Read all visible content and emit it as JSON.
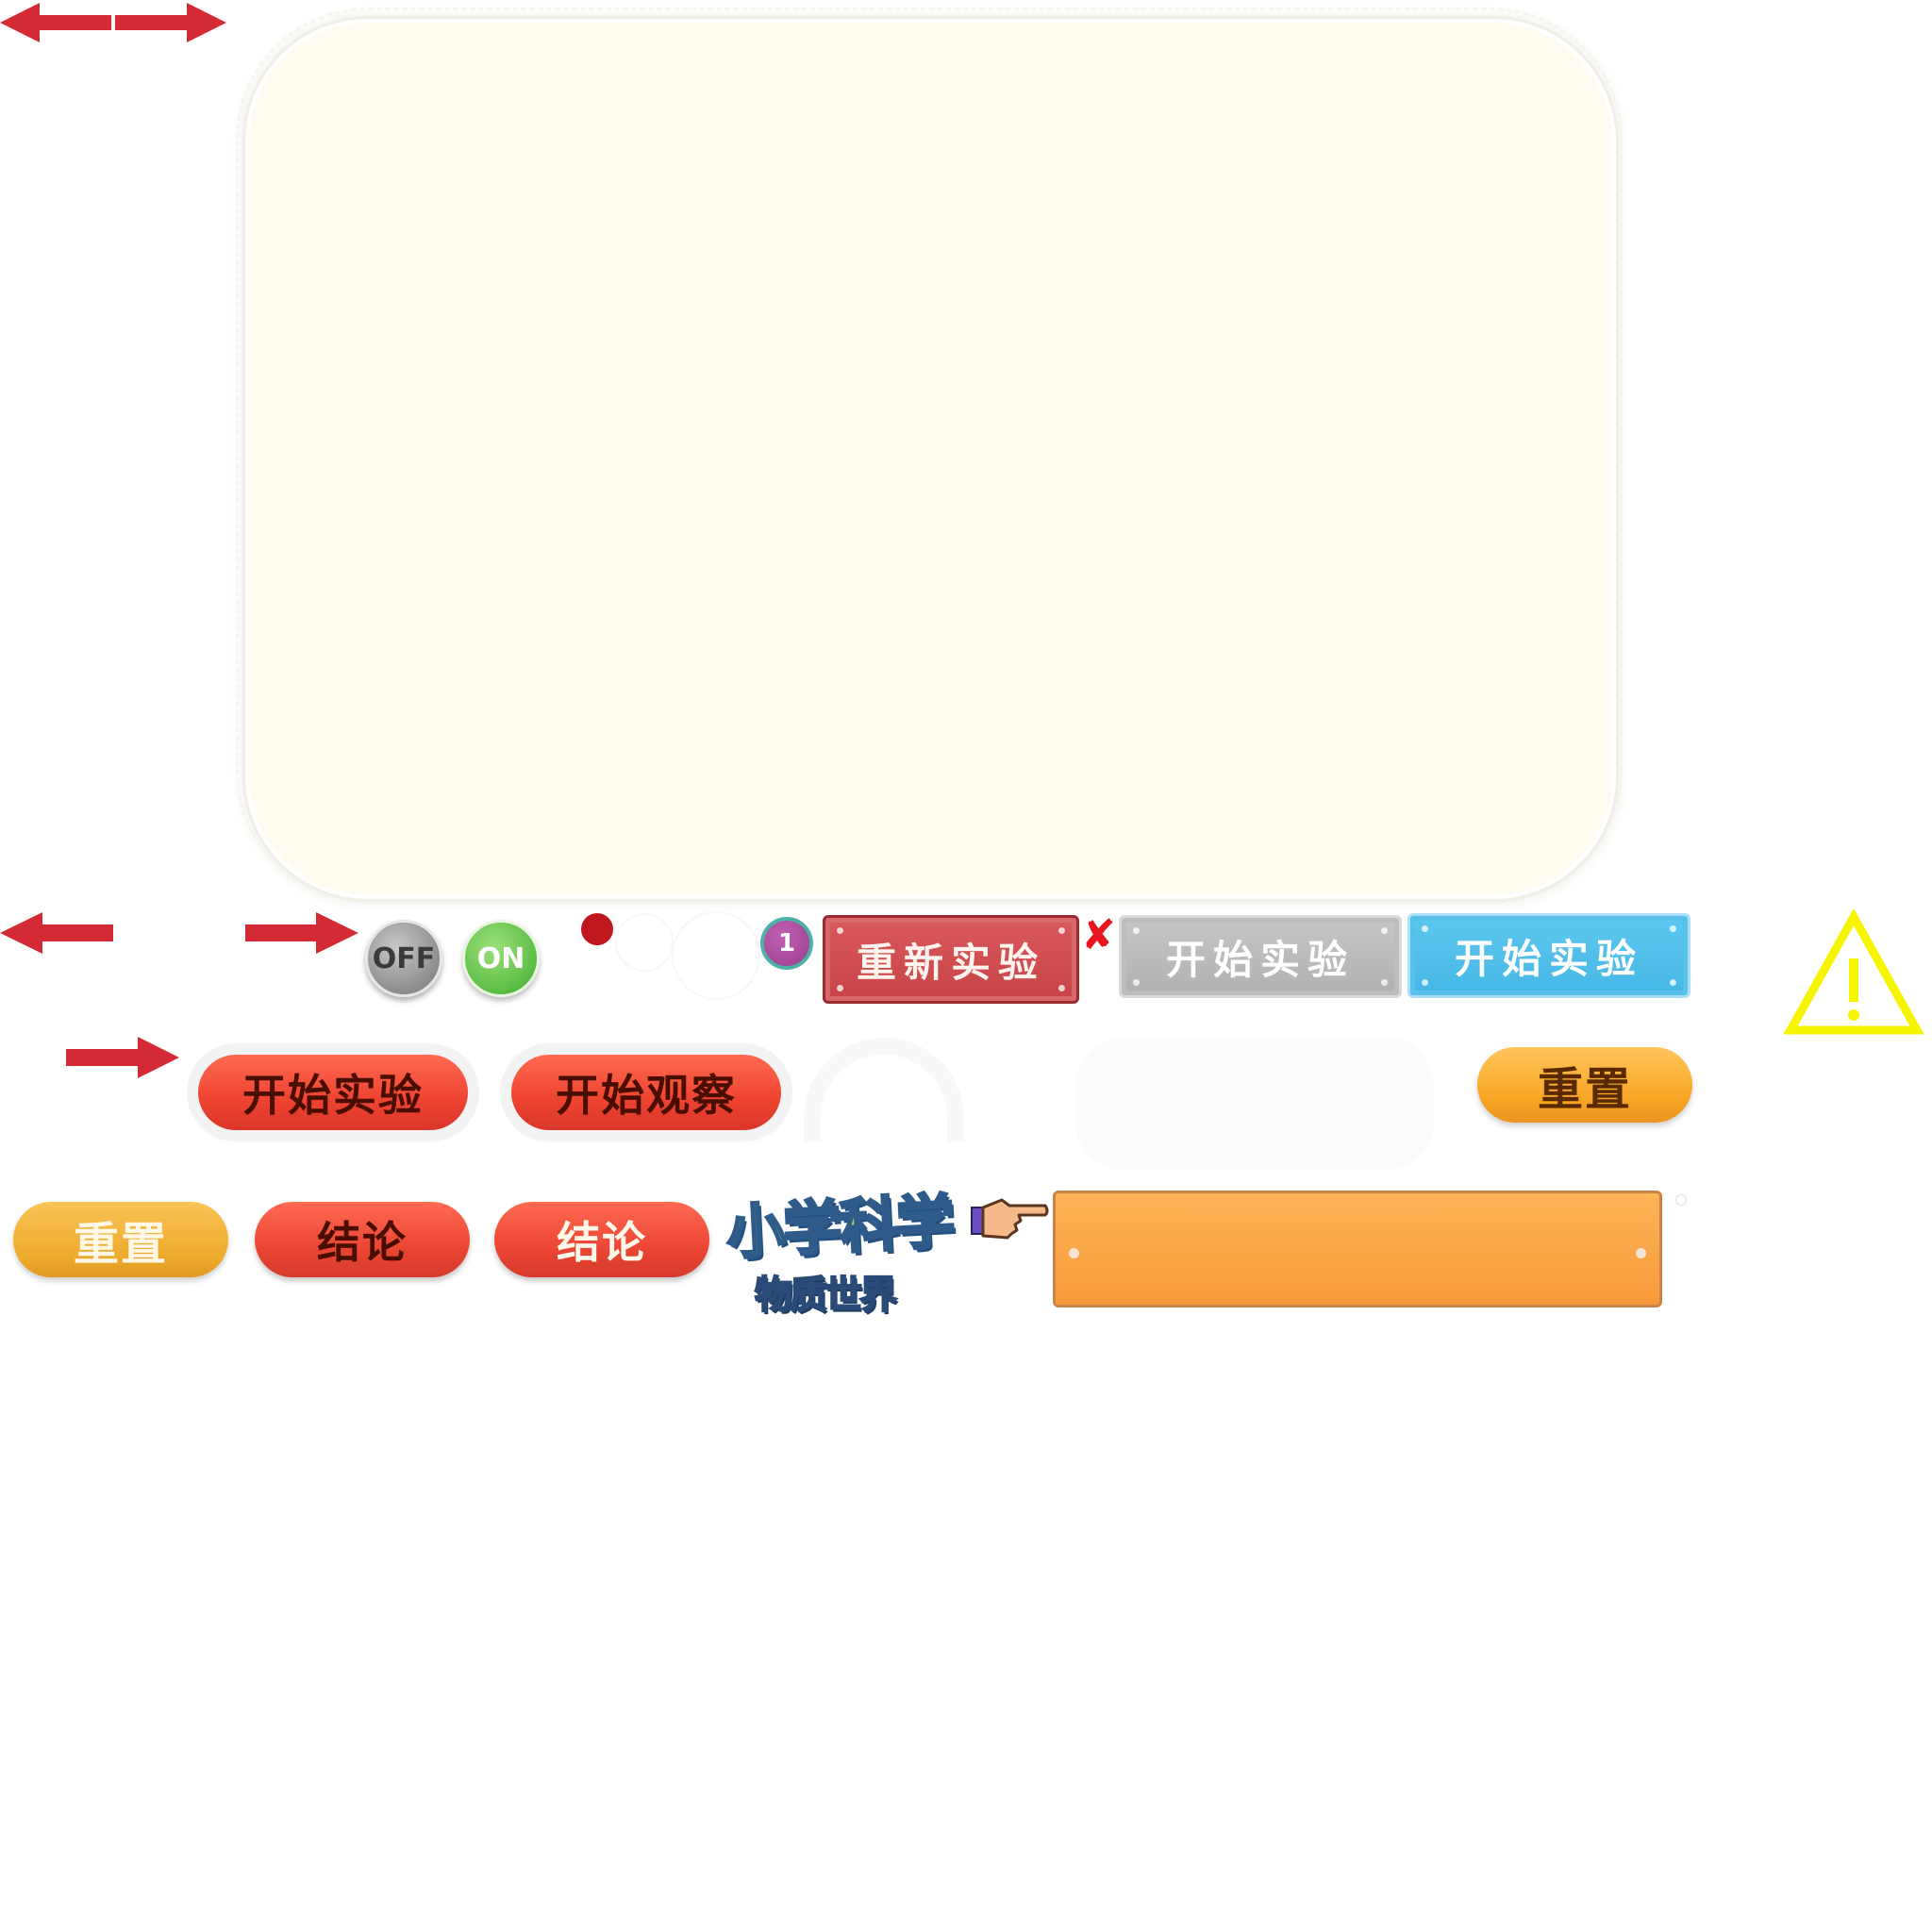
{
  "toggles": {
    "off_label": "OFF",
    "on_label": "ON"
  },
  "badge": {
    "number": "1"
  },
  "top_row": {
    "restart_label": "重新实验",
    "close_glyph": "✘",
    "start_gray_label": "开始实验",
    "start_blue_label": "开始实验",
    "warning_glyph": "!"
  },
  "mid_row": {
    "start_experiment_label": "开始实验",
    "start_observe_label": "开始观察",
    "reset_label": "重置"
  },
  "bottom_row": {
    "reset_label": "重置",
    "conclusion_label_1": "结论",
    "conclusion_label_2": "结论"
  },
  "logo": {
    "line1": "小学科学",
    "line2": "物质世界"
  },
  "colors": {
    "arrow_red": "#d42a36",
    "panel_bg": "#fefcf0",
    "warning_yellow": "#f5f500",
    "close_red": "#e8141e"
  },
  "icons": {
    "arrows": [
      "double-arrow",
      "arrow-left",
      "arrow-right",
      "arrow-right"
    ],
    "pointer": "pointing-hand",
    "warning": "warning-triangle"
  }
}
